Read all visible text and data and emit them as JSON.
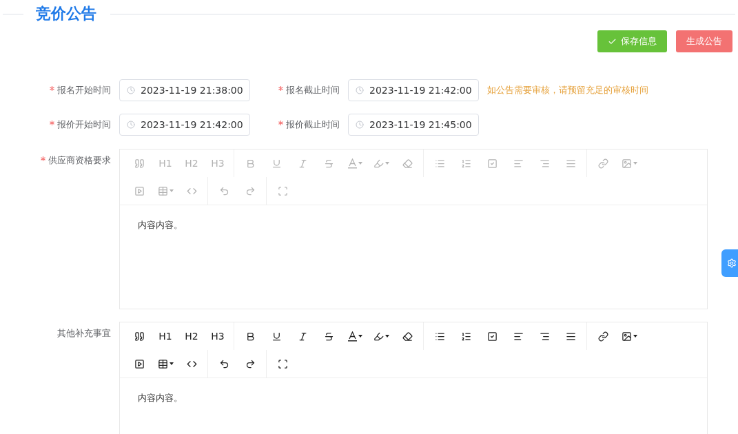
{
  "title": "竞价公告",
  "actions": [
    {
      "label": "保存信息",
      "kind": "save"
    },
    {
      "label": "生成公告",
      "kind": "generate"
    }
  ],
  "time_rows": [
    {
      "fields": [
        {
          "label": "报名开始时间",
          "required": true,
          "value": "2023-11-19 21:38:00"
        },
        {
          "label": "报名截止时间",
          "required": true,
          "value": "2023-11-19 21:42:00"
        }
      ],
      "hint": "如公告需要审核，请预留充足的审核时间"
    },
    {
      "fields": [
        {
          "label": "报价开始时间",
          "required": true,
          "value": "2023-11-19 21:42:00"
        },
        {
          "label": "报价截止时间",
          "required": true,
          "value": "2023-11-19 21:45:00"
        }
      ]
    }
  ],
  "editors": [
    {
      "label": "供应商资格要求",
      "required": true,
      "toolbar_active": false,
      "headings": [
        "H1",
        "H2",
        "H3"
      ],
      "content": "内容内容。"
    },
    {
      "label": "其他补充事宜",
      "required": false,
      "toolbar_active": true,
      "headings": [
        "H1",
        "H2",
        "H3"
      ],
      "content": "内容内容。"
    }
  ]
}
